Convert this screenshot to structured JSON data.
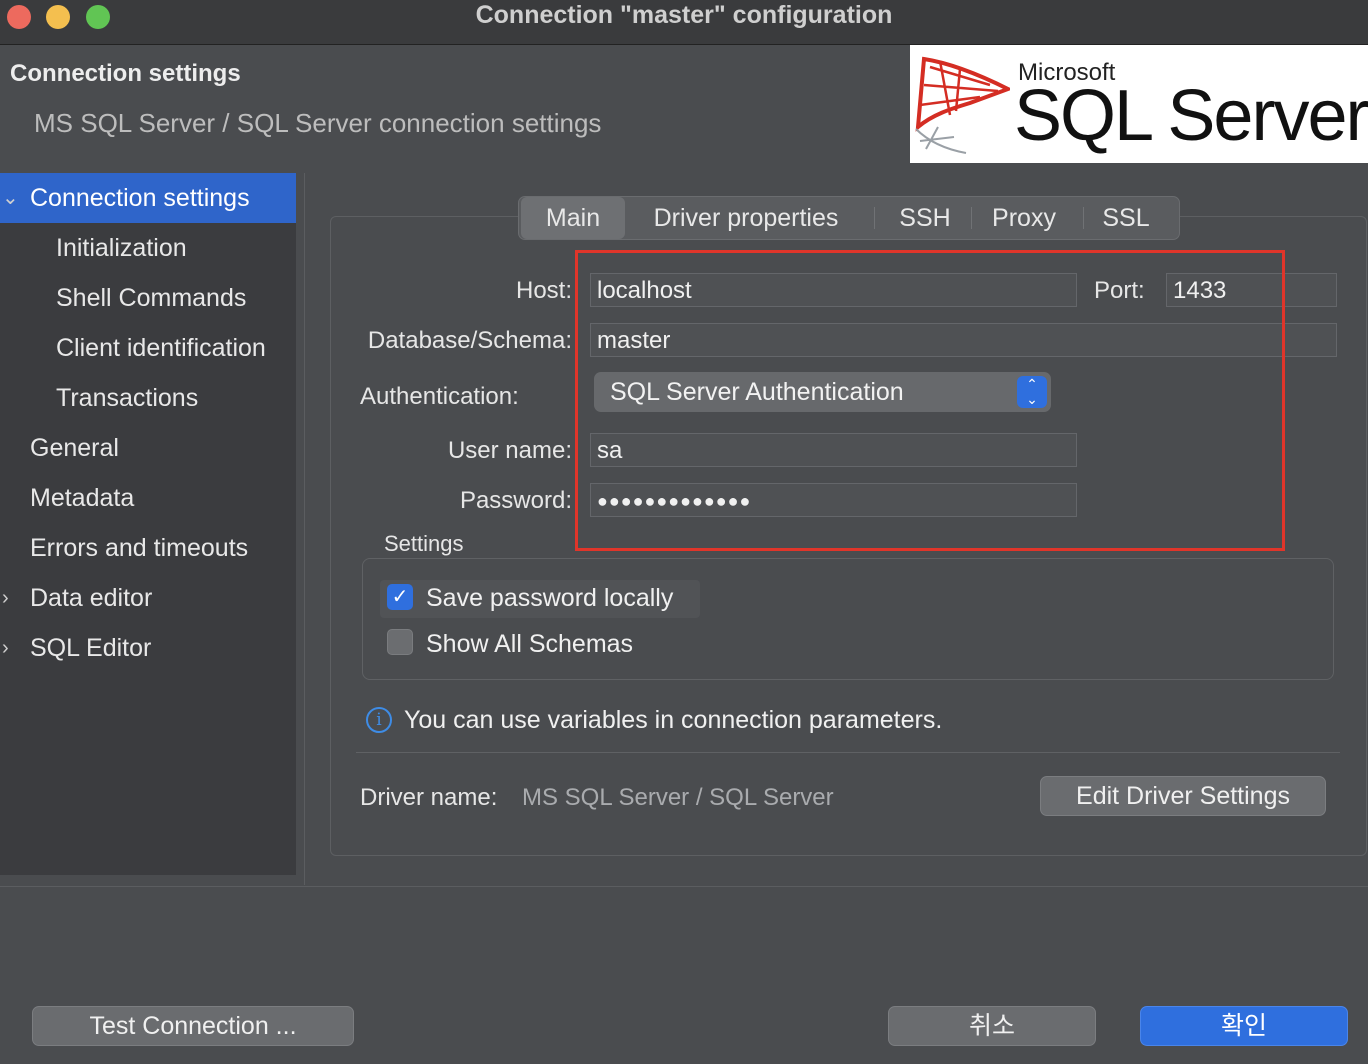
{
  "window": {
    "title": "Connection \"master\" configuration",
    "traffic_colors": [
      "#ed6a5e",
      "#f4bf4f",
      "#61c554"
    ]
  },
  "header": {
    "title": "Connection settings",
    "subtitle": "MS SQL Server / SQL Server connection settings",
    "logo_small": "Microsoft",
    "logo_large": "SQL Server"
  },
  "sidebar": {
    "items": [
      {
        "label": "Connection settings",
        "selected": true,
        "expander": "expanded"
      },
      {
        "label": "Initialization"
      },
      {
        "label": "Shell Commands"
      },
      {
        "label": "Client identification"
      },
      {
        "label": "Transactions"
      },
      {
        "label": "General"
      },
      {
        "label": "Metadata"
      },
      {
        "label": "Errors and timeouts"
      },
      {
        "label": "Data editor",
        "expander": "collapsed"
      },
      {
        "label": "SQL Editor",
        "expander": "collapsed"
      }
    ]
  },
  "tabs": [
    "Main",
    "Driver properties",
    "SSH",
    "Proxy",
    "SSL"
  ],
  "active_tab": "Main",
  "form": {
    "host_label": "Host:",
    "host_value": "localhost",
    "port_label": "Port:",
    "port_value": "1433",
    "database_label": "Database/Schema:",
    "database_value": "master",
    "auth_label": "Authentication:",
    "auth_value": "SQL Server Authentication",
    "user_label": "User name:",
    "user_value": "sa",
    "password_label": "Password:",
    "password_value": "●●●●●●●●●●●●●"
  },
  "settings": {
    "title": "Settings",
    "save_password": {
      "label": "Save password locally",
      "checked": true
    },
    "show_all_schemas": {
      "label": "Show All Schemas",
      "checked": false
    }
  },
  "hint": "You can use variables in connection parameters.",
  "driver": {
    "label": "Driver name:",
    "value": "MS SQL Server / SQL Server",
    "edit_button": "Edit Driver Settings"
  },
  "buttons": {
    "test_connection": "Test Connection ...",
    "cancel": "취소",
    "ok": "확인"
  },
  "colors": {
    "accent": "#2f65ca",
    "highlight_box": "#e0352a",
    "ok_button": "#2f6fde"
  }
}
